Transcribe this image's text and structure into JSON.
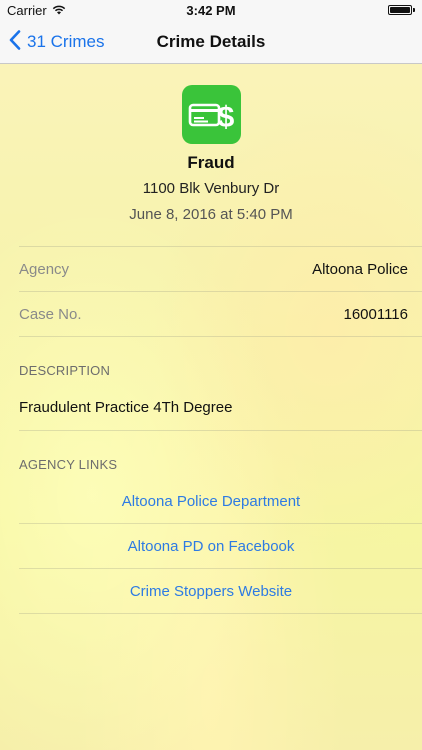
{
  "status_bar": {
    "carrier": "Carrier",
    "time": "3:42 PM",
    "icons": [
      "wifi-icon",
      "battery-icon"
    ]
  },
  "nav": {
    "back_label": "31 Crimes",
    "title": "Crime Details",
    "back_icon": "chevron-left-icon"
  },
  "crime": {
    "icon": "credit-card-dollar-icon",
    "type": "Fraud",
    "address": "1100 Blk Venbury Dr",
    "datetime": "June 8, 2016 at 5:40 PM"
  },
  "details": {
    "agency_label": "Agency",
    "agency_value": "Altoona Police",
    "case_label": "Case No.",
    "case_value": "16001116"
  },
  "description": {
    "header": "DESCRIPTION",
    "text": "Fraudulent Practice 4Th Degree"
  },
  "links": {
    "header": "AGENCY LINKS",
    "items": [
      {
        "label": "Altoona Police Department"
      },
      {
        "label": "Altoona PD on Facebook"
      },
      {
        "label": "Crime Stoppers Website"
      }
    ]
  },
  "colors": {
    "accent": "#1a73ea",
    "link": "#2e7be3",
    "icon_bg": "#3ac43a",
    "background": "#f7f3ae"
  }
}
